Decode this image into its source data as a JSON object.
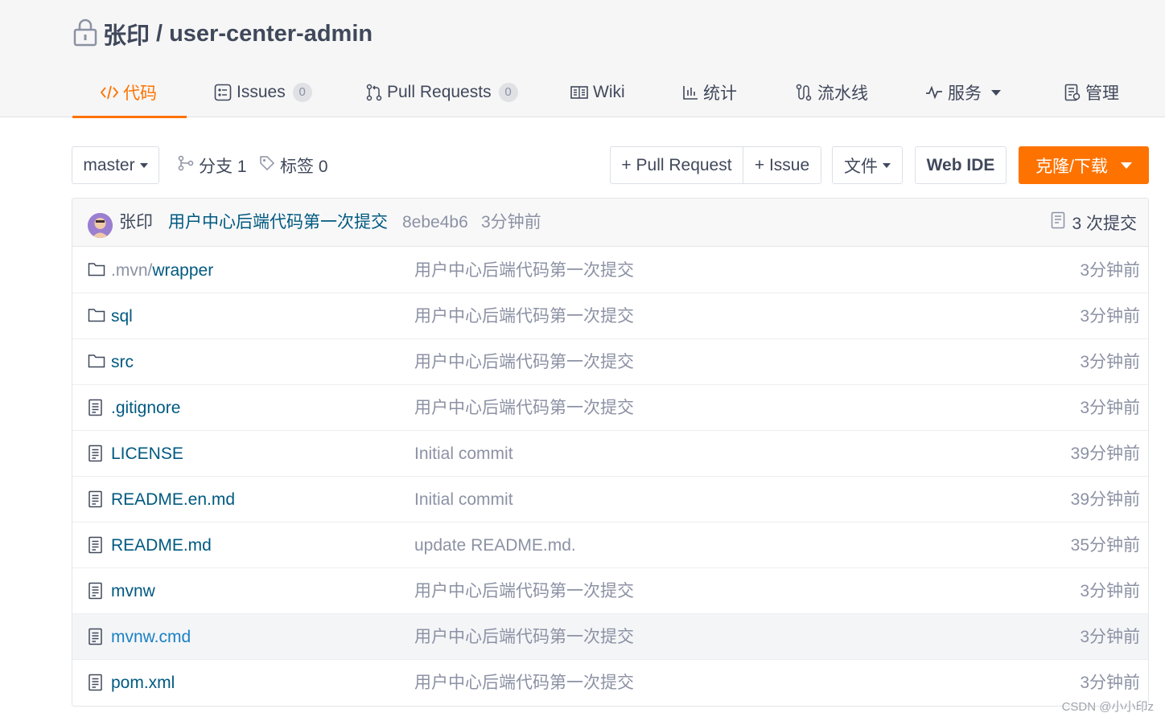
{
  "repo": {
    "owner": "张印",
    "separator": "/",
    "name": "user-center-admin",
    "lock_icon": "lock-icon"
  },
  "tabs": [
    {
      "label": "代码",
      "icon": "code-icon",
      "active": true
    },
    {
      "label": "Issues",
      "icon": "issues-icon",
      "badge": "0"
    },
    {
      "label": "Pull Requests",
      "icon": "pull-request-icon",
      "badge": "0"
    },
    {
      "label": "Wiki",
      "icon": "wiki-icon"
    },
    {
      "label": "统计",
      "icon": "chart-icon"
    },
    {
      "label": "流水线",
      "icon": "pipeline-icon"
    },
    {
      "label": "服务",
      "icon": "pulse-icon",
      "dropdown": true
    },
    {
      "label": "管理",
      "icon": "manage-icon"
    }
  ],
  "toolbar": {
    "branch": "master",
    "branches_label": "分支 1",
    "tags_label": "标签 0",
    "new_pr_label": "+ Pull Request",
    "new_issue_label": "+ Issue",
    "file_label": "文件",
    "web_ide_label": "Web IDE",
    "clone_label": "克隆/下载"
  },
  "commit": {
    "author": "张印",
    "message": "用户中心后端代码第一次提交",
    "sha": "8ebe4b6",
    "time": "3分钟前",
    "count_label": "3 次提交"
  },
  "files": [
    {
      "type": "folder",
      "name_prefix": ".mvn/",
      "name": "wrapper",
      "message": "用户中心后端代码第一次提交",
      "time": "3分钟前"
    },
    {
      "type": "folder",
      "name_prefix": "",
      "name": "sql",
      "message": "用户中心后端代码第一次提交",
      "time": "3分钟前"
    },
    {
      "type": "folder",
      "name_prefix": "",
      "name": "src",
      "message": "用户中心后端代码第一次提交",
      "time": "3分钟前"
    },
    {
      "type": "file",
      "name_prefix": "",
      "name": ".gitignore",
      "message": "用户中心后端代码第一次提交",
      "time": "3分钟前"
    },
    {
      "type": "file",
      "name_prefix": "",
      "name": "LICENSE",
      "message": "Initial commit",
      "time": "39分钟前"
    },
    {
      "type": "file",
      "name_prefix": "",
      "name": "README.en.md",
      "message": "Initial commit",
      "time": "39分钟前"
    },
    {
      "type": "file",
      "name_prefix": "",
      "name": "README.md",
      "message": "update README.md.",
      "time": "35分钟前"
    },
    {
      "type": "file",
      "name_prefix": "",
      "name": "mvnw",
      "message": "用户中心后端代码第一次提交",
      "time": "3分钟前"
    },
    {
      "type": "file",
      "name_prefix": "",
      "name": "mvnw.cmd",
      "message": "用户中心后端代码第一次提交",
      "time": "3分钟前",
      "hovered": true
    },
    {
      "type": "file",
      "name_prefix": "",
      "name": "pom.xml",
      "message": "用户中心后端代码第一次提交",
      "time": "3分钟前"
    }
  ],
  "watermark": "CSDN @小小印z",
  "colors": {
    "accent": "#fe7300",
    "link": "#005980",
    "muted": "#8c92a4"
  }
}
